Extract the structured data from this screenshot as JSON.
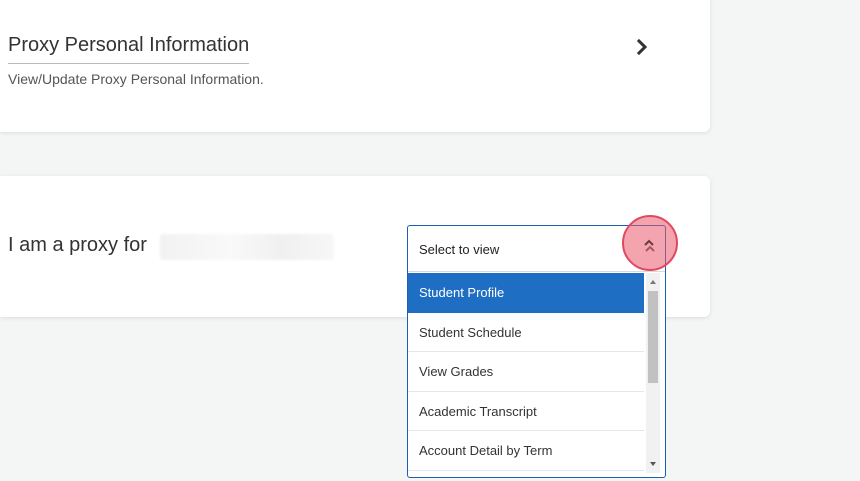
{
  "personal_info_card": {
    "title": "Proxy Personal Information",
    "description": "View/Update Proxy Personal Information.",
    "icon": "chevron-right-icon"
  },
  "proxy_card": {
    "label": "I am a proxy for"
  },
  "select": {
    "placeholder": "Select to view",
    "selected": "Student Profile",
    "options": [
      "Student Profile",
      "Student Schedule",
      "View Grades",
      "Academic Transcript",
      "Account Detail by Term"
    ],
    "toggle_icon": "chevron-up-icon"
  },
  "colors": {
    "accent": "#1e6ec4",
    "select_border": "#1a5fb4",
    "click_indicator": "#e04a60"
  }
}
